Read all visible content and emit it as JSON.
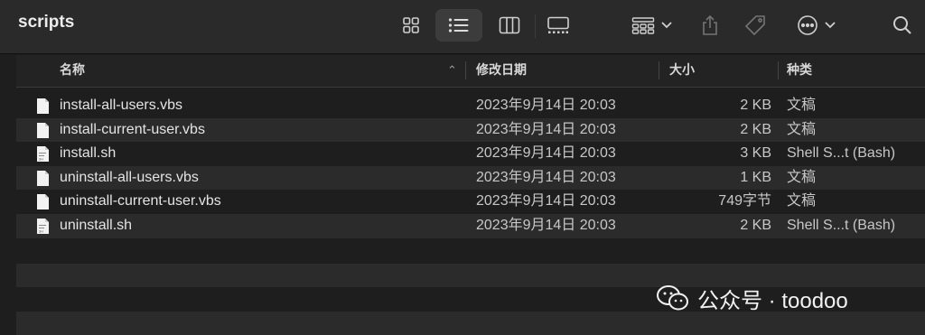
{
  "window": {
    "title": "scripts"
  },
  "columns": {
    "name": "名称",
    "date": "修改日期",
    "size": "大小",
    "kind": "种类"
  },
  "files": [
    {
      "name": "install-all-users.vbs",
      "date": "2023年9月14日 20:03",
      "size": "2 KB",
      "kind": "文稿",
      "icon": "document-icon"
    },
    {
      "name": "install-current-user.vbs",
      "date": "2023年9月14日 20:03",
      "size": "2 KB",
      "kind": "文稿",
      "icon": "document-icon"
    },
    {
      "name": "install.sh",
      "date": "2023年9月14日 20:03",
      "size": "3 KB",
      "kind": "Shell S...t (Bash)",
      "icon": "shell-script-icon"
    },
    {
      "name": "uninstall-all-users.vbs",
      "date": "2023年9月14日 20:03",
      "size": "1 KB",
      "kind": "文稿",
      "icon": "document-icon"
    },
    {
      "name": "uninstall-current-user.vbs",
      "date": "2023年9月14日 20:03",
      "size": "749字节",
      "kind": "文稿",
      "icon": "document-icon"
    },
    {
      "name": "uninstall.sh",
      "date": "2023年9月14日 20:03",
      "size": "2 KB",
      "kind": "Shell S...t (Bash)",
      "icon": "shell-script-icon"
    }
  ],
  "watermark": {
    "text": "公众号 · toodoo",
    "icon": "wechat-icon"
  },
  "colors": {
    "background": "#1e1e1e",
    "toolbar": "#2a2a2a",
    "stripe": "#2b2b2b",
    "text": "#e4e4e4"
  }
}
